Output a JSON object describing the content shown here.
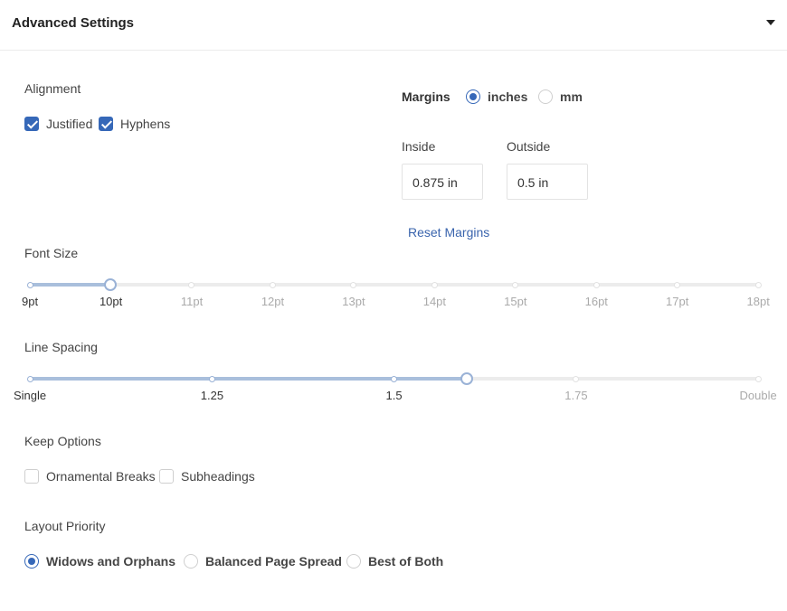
{
  "header": {
    "title": "Advanced Settings",
    "toggle_icon": "caret-down-icon"
  },
  "alignment": {
    "label": "Alignment",
    "options": [
      {
        "label": "Justified",
        "checked": true
      },
      {
        "label": "Hyphens",
        "checked": true
      }
    ]
  },
  "margins": {
    "label": "Margins",
    "units": [
      {
        "label": "inches",
        "selected": true
      },
      {
        "label": "mm",
        "selected": false
      }
    ],
    "inside": {
      "label": "Inside",
      "value": "0.875 in"
    },
    "outside": {
      "label": "Outside",
      "value": "0.5 in"
    },
    "reset_label": "Reset Margins"
  },
  "font_size": {
    "label": "Font Size",
    "ticks": [
      "9pt",
      "10pt",
      "11pt",
      "12pt",
      "13pt",
      "14pt",
      "15pt",
      "16pt",
      "17pt",
      "18pt"
    ],
    "selected": "10pt"
  },
  "line_spacing": {
    "label": "Line Spacing",
    "ticks": [
      "Single",
      "1.25",
      "1.5",
      "1.75",
      "Double"
    ],
    "value": 1.6
  },
  "keep_options": {
    "label": "Keep Options",
    "options": [
      {
        "label": "Ornamental Breaks",
        "checked": false
      },
      {
        "label": "Subheadings",
        "checked": false
      }
    ]
  },
  "layout_priority": {
    "label": "Layout Priority",
    "options": [
      {
        "label": "Widows and Orphans",
        "selected": true
      },
      {
        "label": "Balanced Page Spread",
        "selected": false
      },
      {
        "label": "Best of Both",
        "selected": false
      }
    ]
  },
  "colors": {
    "accent": "#3668b8",
    "slider_fill": "#a9bfdc",
    "link": "#3a64ad"
  }
}
